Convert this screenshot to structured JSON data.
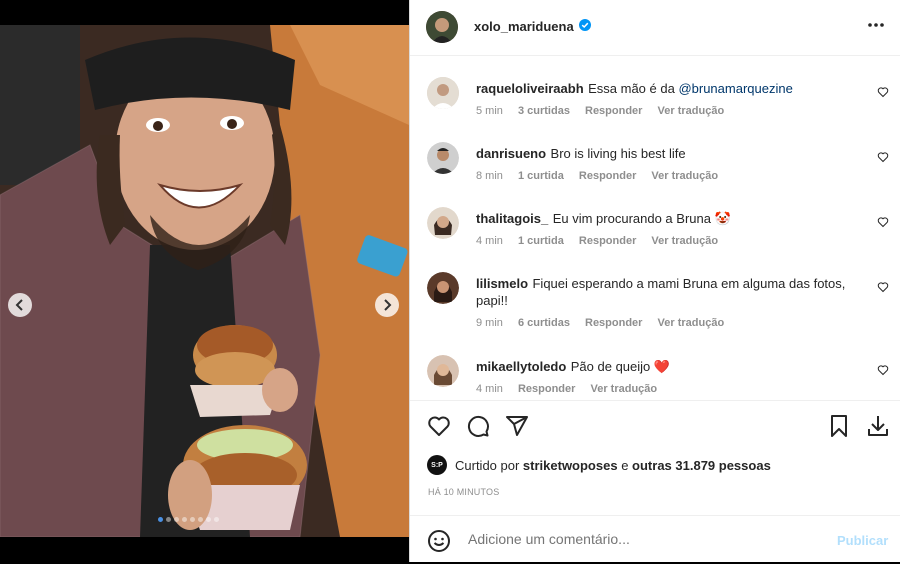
{
  "post": {
    "username": "xolo_mariduena",
    "verified": true,
    "more_icon": "more-horizontal-icon"
  },
  "media": {
    "carousel_dots": 8,
    "active_dot": 1
  },
  "comments": [
    {
      "user": "raqueloliveiraabh",
      "text": "Essa mão é da ",
      "mention": "@brunamarquezine",
      "time": "5 min",
      "likes": "3 curtidas",
      "reply": "Responder",
      "translate": "Ver tradução"
    },
    {
      "user": "danrisueno",
      "text": "Bro is living his best life",
      "time": "8 min",
      "likes": "1 curtida",
      "reply": "Responder",
      "translate": "Ver tradução"
    },
    {
      "user": "thalitagois_",
      "text": "Eu vim procurando a Bruna 🤡",
      "time": "4 min",
      "likes": "1 curtida",
      "reply": "Responder",
      "translate": "Ver tradução"
    },
    {
      "user": "lilismelo",
      "text": "Fiquei esperando a mami Bruna em alguma das fotos, papi!!",
      "time": "9 min",
      "likes": "6 curtidas",
      "reply": "Responder",
      "translate": "Ver tradução"
    },
    {
      "user": "mikaellytoledo",
      "text": "Pão de queijo ❤️",
      "time": "4 min",
      "reply": "Responder",
      "translate": "Ver tradução"
    }
  ],
  "likes": {
    "prefix": "Curtido por ",
    "user": "striketwoposes",
    "middle": " e ",
    "others": "outras 31.879 pessoas",
    "avatar_text": "S:P"
  },
  "timestamp": "HÁ 10 MINUTOS",
  "composer": {
    "placeholder": "Adicione um comentário...",
    "publish": "Publicar"
  },
  "colors": {
    "mention": "#00376b",
    "verified": "#0095f6",
    "publish_disabled": "#b2dffc"
  }
}
